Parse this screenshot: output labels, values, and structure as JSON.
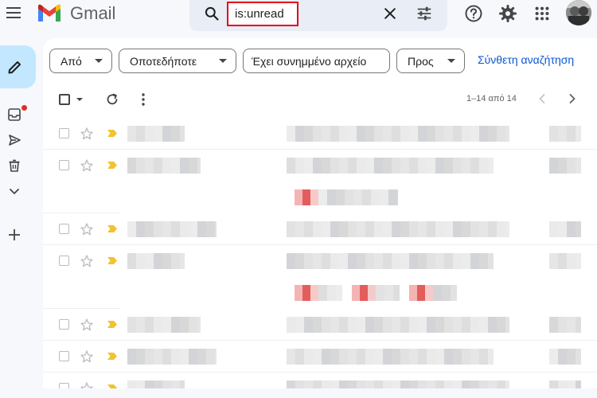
{
  "app": {
    "name": "Gmail"
  },
  "search": {
    "value": "is:unread"
  },
  "filters": [
    {
      "label": "Από"
    },
    {
      "label": "Οποτεδήποτε"
    },
    {
      "label": "Έχει συνημμένο αρχείο"
    },
    {
      "label": "Προς"
    }
  ],
  "advanced_search": "Σύνθετη αναζήτηση",
  "pagination": "1–14 από 14",
  "icons": {
    "menu": "menu-icon",
    "search": "search-icon",
    "clear": "close-icon",
    "tune": "tune-icon",
    "help": "help-icon",
    "settings": "gear-icon",
    "apps": "apps-icon",
    "compose": "pencil-icon",
    "inbox": "inbox-icon",
    "sent": "send-icon",
    "trash": "trash-icon",
    "more": "chevron-down-icon",
    "add": "plus-icon",
    "refresh": "refresh-icon",
    "overflow": "more-vert-icon",
    "prev": "chevron-left-icon",
    "next": "chevron-right-icon",
    "star": "star-icon",
    "important": "important-marker-icon"
  },
  "colors": {
    "accent": "#0b57d0",
    "compose_bg": "#c2e7ff",
    "search_bg": "#e9eef6",
    "highlight_border": "#e3001b",
    "important_marker": "#f2c230",
    "badge": "#d93025"
  },
  "email_rows": [
    {
      "has_attachments": false
    },
    {
      "has_attachments": true,
      "attachment_count": 1
    },
    {
      "has_attachments": false
    },
    {
      "has_attachments": true,
      "attachment_count": 3
    },
    {
      "has_attachments": false
    },
    {
      "has_attachments": false
    },
    {
      "has_attachments": false
    }
  ]
}
